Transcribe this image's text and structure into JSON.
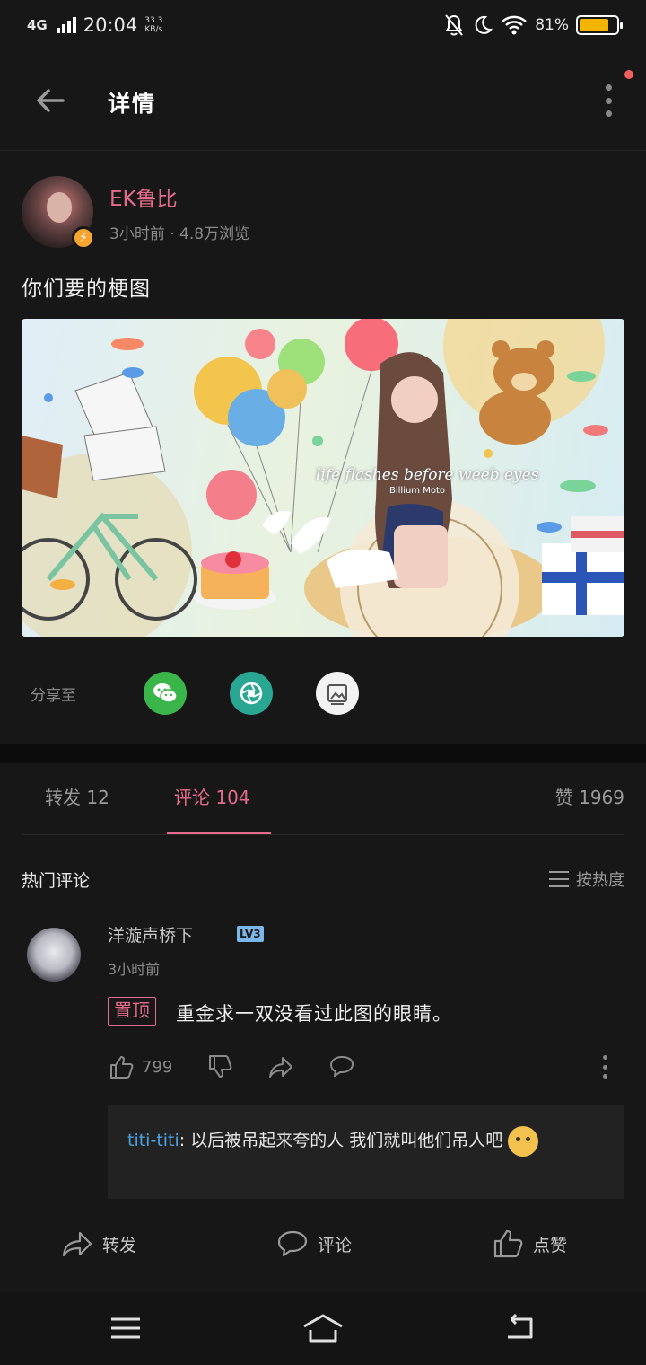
{
  "status_bar": {
    "network": "4G",
    "time": "20:04",
    "speed_value": "33.3",
    "speed_unit": "KB/s",
    "battery_percent": "81%",
    "battery_level": 0.81
  },
  "header": {
    "title": "详情"
  },
  "post": {
    "author": "EK鲁比",
    "meta": "3小时前 · 4.8万浏览",
    "text": "你们要的梗图",
    "image_caption": "life flashes before weeb eyes",
    "image_subcaption": "Billium Moto"
  },
  "share": {
    "label": "分享至"
  },
  "tabs": {
    "repost_label": "转发",
    "repost_count": "12",
    "comments_label": "评论",
    "comments_count": "104",
    "likes_label": "赞",
    "likes_count": "1969"
  },
  "comments_section": {
    "title": "热门评论",
    "sort_label": "按热度"
  },
  "comment": {
    "username": "洋漩声桥下",
    "level": "LV3",
    "time": "3小时前",
    "pin_label": "置顶",
    "text": "重金求一双没看过此图的眼睛。",
    "like_count": "799",
    "reply": {
      "user": "titi-titi",
      "text": "以后被吊起来夸的人 我们就叫他们吊人吧"
    }
  },
  "bottom_actions": {
    "repost": "转发",
    "comment": "评论",
    "like": "点赞"
  },
  "colors": {
    "accent": "#e56b8a",
    "link": "#4aa3df",
    "background": "#171717"
  }
}
